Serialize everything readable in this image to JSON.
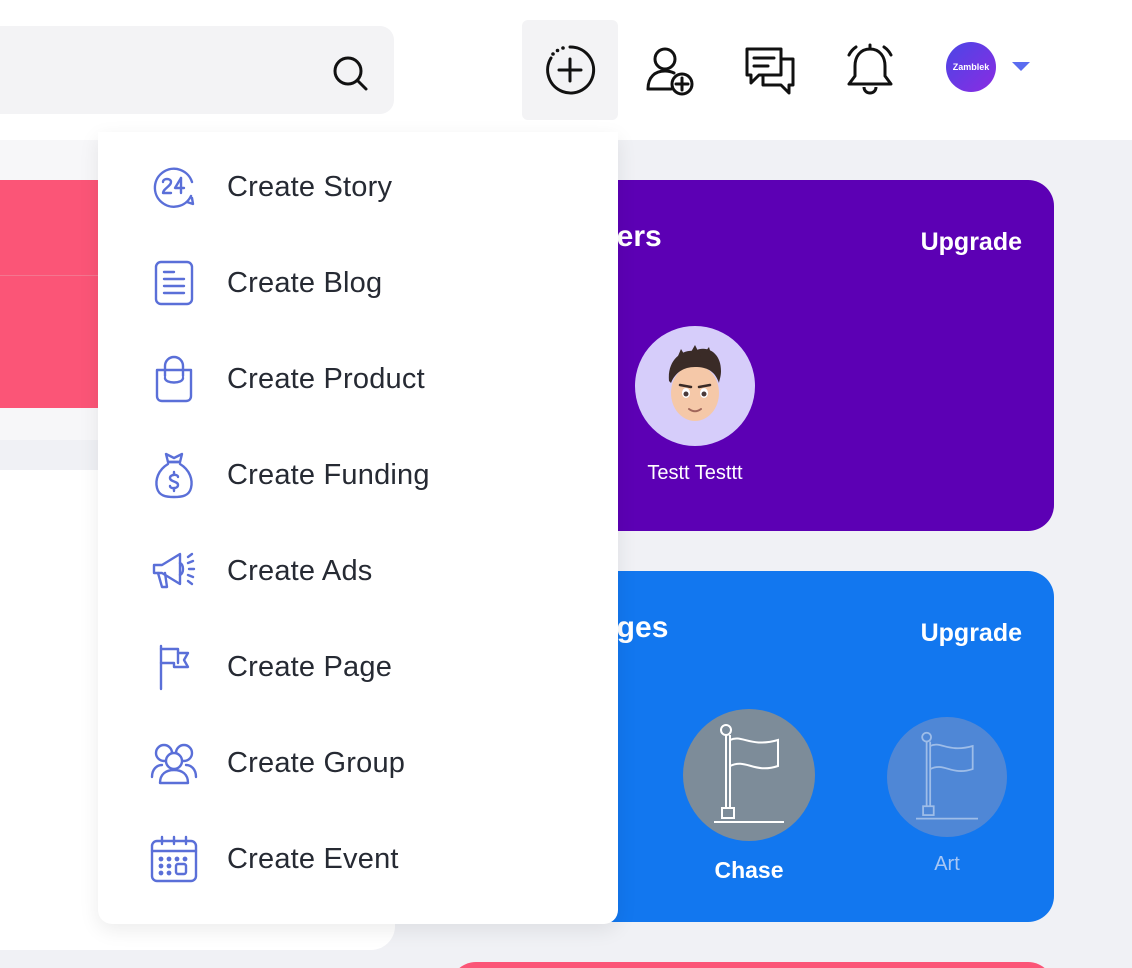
{
  "header": {
    "avatar_text": "Zamblek"
  },
  "create_menu": {
    "items": [
      {
        "label": "Create Story",
        "icon": "story-24-icon"
      },
      {
        "label": "Create Blog",
        "icon": "document-icon"
      },
      {
        "label": "Create Product",
        "icon": "shopping-bag-icon"
      },
      {
        "label": "Create Funding",
        "icon": "money-bag-icon"
      },
      {
        "label": "Create Ads",
        "icon": "megaphone-icon"
      },
      {
        "label": "Create Page",
        "icon": "flag-icon"
      },
      {
        "label": "Create Group",
        "icon": "group-icon"
      },
      {
        "label": "Create Event",
        "icon": "calendar-icon"
      }
    ]
  },
  "users_card": {
    "title": "sers",
    "upgrade_label": "Upgrade",
    "user_name": "Testt Testtt"
  },
  "pages_card": {
    "title": "ages",
    "upgrade_label": "Upgrade",
    "pages": [
      {
        "name": "Chase"
      },
      {
        "name": "Art"
      }
    ]
  },
  "colors": {
    "accent": "#5b6cf0",
    "icon_blue": "#5a6fd8",
    "users_card": "#5c00b4",
    "pages_card": "#1277ef",
    "pink": "#fb5577"
  }
}
